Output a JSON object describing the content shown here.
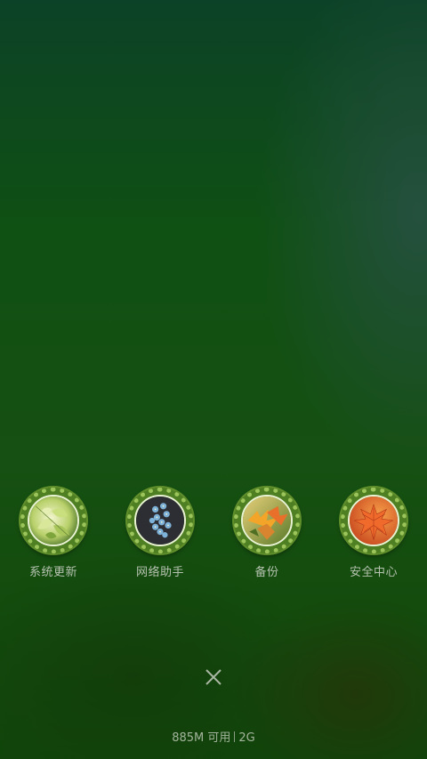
{
  "apps": [
    {
      "label": "系统更新",
      "icon": "green-leaves-icon"
    },
    {
      "label": "网络助手",
      "icon": "blue-flowers-icon"
    },
    {
      "label": "备份",
      "icon": "autumn-leaves-icon"
    },
    {
      "label": "安全中心",
      "icon": "maple-leaf-icon"
    }
  ],
  "close_icon": "close-icon",
  "status": {
    "memory": "885M 可用",
    "total": "2G"
  },
  "colors": {
    "ring": "#9bc45a",
    "label": "#b6c2b0"
  }
}
